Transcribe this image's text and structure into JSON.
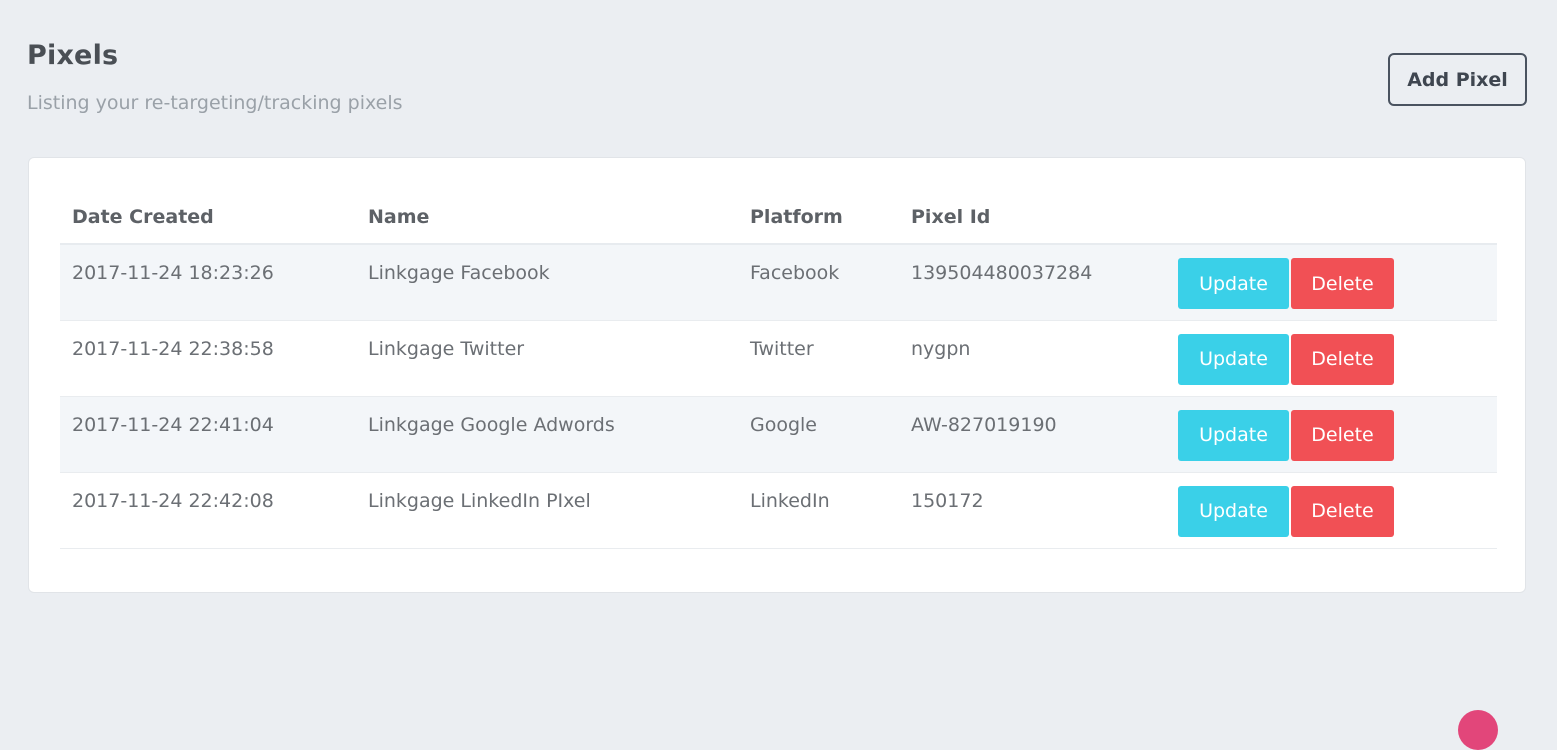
{
  "header": {
    "title": "Pixels",
    "subtitle": "Listing your re-targeting/tracking pixels",
    "add_button_label": "Add Pixel"
  },
  "table": {
    "columns": [
      "Date Created",
      "Name",
      "Platform",
      "Pixel Id",
      ""
    ],
    "rows": [
      {
        "date_created": "2017-11-24 18:23:26",
        "name": "Linkgage Facebook",
        "platform": "Facebook",
        "pixel_id": "139504480037284",
        "update_label": "Update",
        "delete_label": "Delete"
      },
      {
        "date_created": "2017-11-24 22:38:58",
        "name": "Linkgage Twitter",
        "platform": "Twitter",
        "pixel_id": "nygpn",
        "update_label": "Update",
        "delete_label": "Delete"
      },
      {
        "date_created": "2017-11-24 22:41:04",
        "name": "Linkgage Google Adwords",
        "platform": "Google",
        "pixel_id": "AW-827019190",
        "update_label": "Update",
        "delete_label": "Delete"
      },
      {
        "date_created": "2017-11-24 22:42:08",
        "name": "Linkgage LinkedIn PIxel",
        "platform": "LinkedIn",
        "pixel_id": "150172",
        "update_label": "Update",
        "delete_label": "Delete"
      }
    ]
  },
  "colors": {
    "update_button": "#3ad0e8",
    "delete_button": "#f15055",
    "page_background": "#ebeef2"
  }
}
